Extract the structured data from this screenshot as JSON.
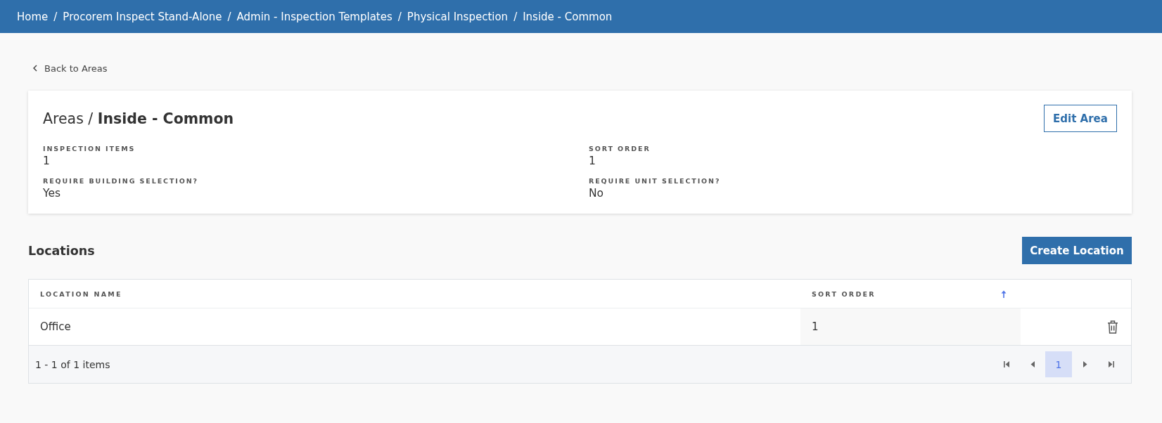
{
  "breadcrumb": {
    "separator": "/",
    "items": [
      {
        "label": "Home"
      },
      {
        "label": "Procorem Inspect Stand-Alone"
      },
      {
        "label": "Admin - Inspection Templates"
      },
      {
        "label": "Physical Inspection"
      },
      {
        "label": "Inside - Common"
      }
    ]
  },
  "back_link": {
    "label": "Back to Areas"
  },
  "area_card": {
    "title": "Areas / **Inside - Common**",
    "edit_button": "Edit Area",
    "fields": [
      {
        "label": "INSPECTION ITEMS",
        "value": "1"
      },
      {
        "label": "SORT ORDER",
        "value": "1"
      },
      {
        "label": "REQUIRE BUILDING SELECTION?",
        "value": "Yes"
      },
      {
        "label": "REQUIRE UNIT SELECTION?",
        "value": "No"
      }
    ]
  },
  "locations": {
    "title": "Locations",
    "create_button": "Create Location",
    "table": {
      "columns": [
        {
          "label": "LOCATION NAME",
          "sorted": false
        },
        {
          "label": "SORT ORDER",
          "sorted": true,
          "ascending": true
        }
      ],
      "rows": [
        {
          "cells": [
            "Office",
            "1"
          ]
        }
      ]
    },
    "pager": {
      "summary": "1 - 1 of 1 items",
      "pages": [
        {
          "label": "1",
          "selected": true
        }
      ]
    }
  }
}
